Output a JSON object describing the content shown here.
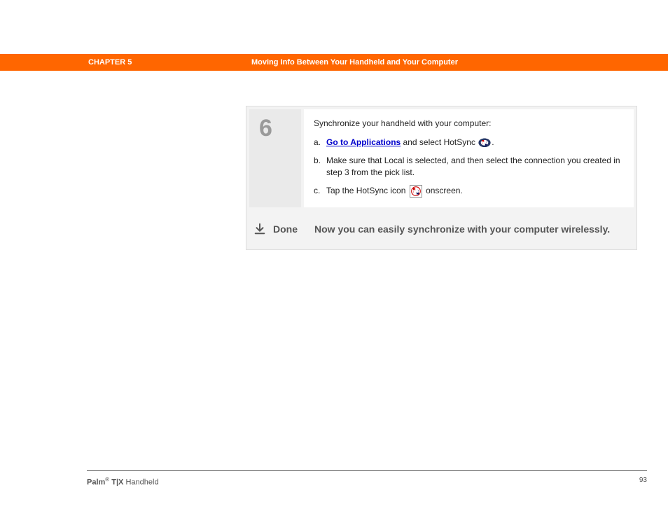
{
  "header": {
    "chapter": "CHAPTER 5",
    "section": "Moving Info Between Your Handheld and Your Computer"
  },
  "step": {
    "number": "6",
    "intro": "Synchronize your handheld with your computer:",
    "items": [
      {
        "letter": "a.",
        "link": "Go to Applications",
        "after_link": " and select HotSync ",
        "tail": "."
      },
      {
        "letter": "b.",
        "text": "Make sure that Local is selected, and then select the connection you created in step 3 from the pick list."
      },
      {
        "letter": "c.",
        "before_icon": "Tap the HotSync icon ",
        "after_icon": " onscreen."
      }
    ]
  },
  "done": {
    "label": "Done",
    "text": "Now you can easily synchronize with your computer wirelessly."
  },
  "footer": {
    "brand_bold": "Palm",
    "reg": "®",
    "model_bold": " T|X",
    "suffix": " Handheld",
    "page": "93"
  }
}
